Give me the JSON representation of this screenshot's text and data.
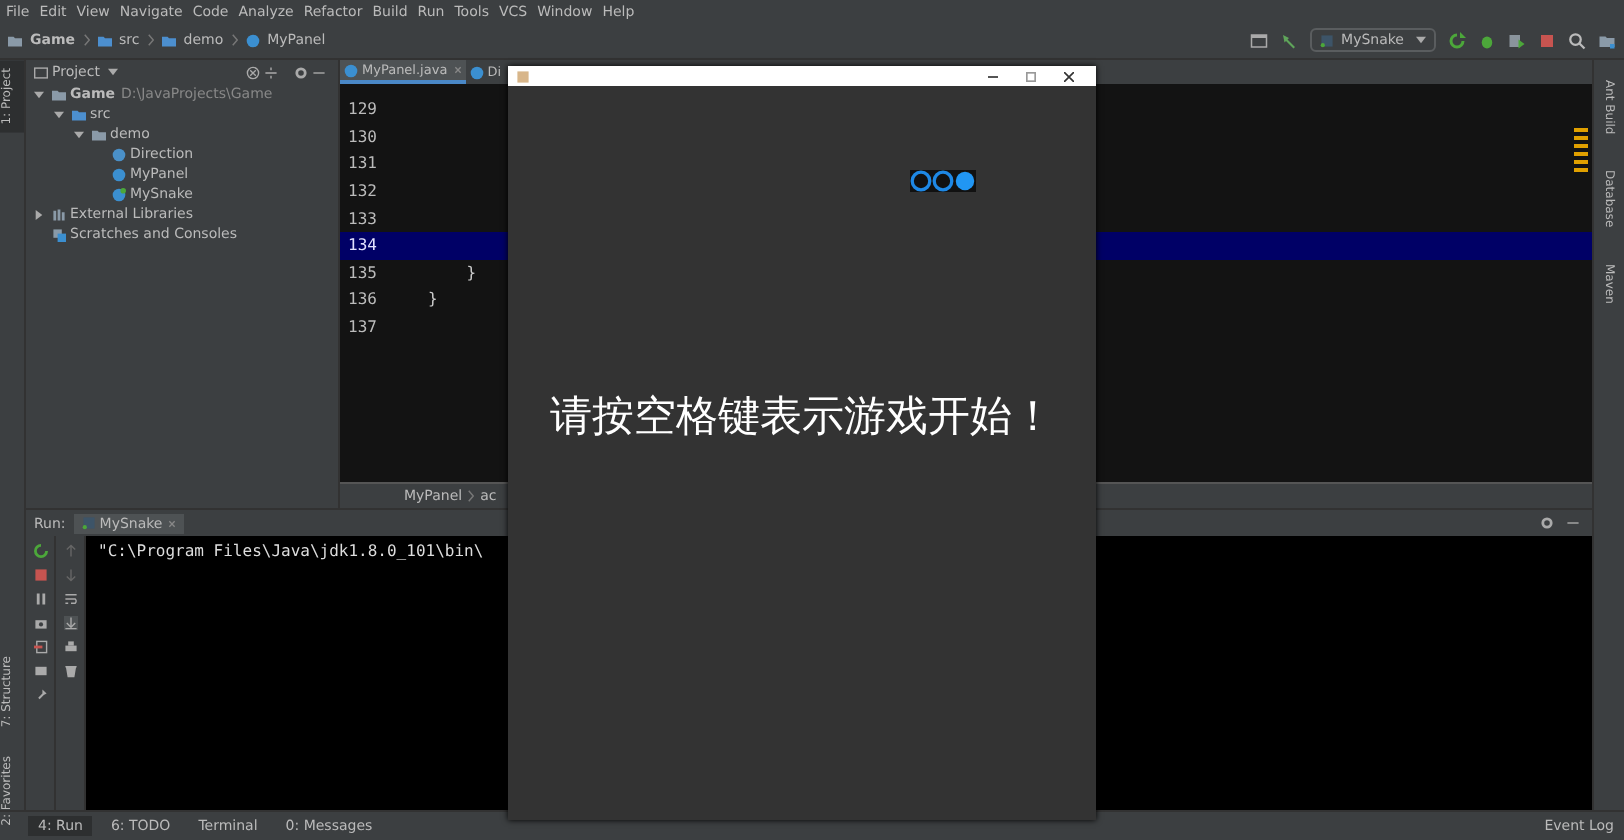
{
  "menu": [
    "File",
    "Edit",
    "View",
    "Navigate",
    "Code",
    "Analyze",
    "Refactor",
    "Build",
    "Run",
    "Tools",
    "VCS",
    "Window",
    "Help"
  ],
  "breadcrumb": [
    "Game",
    "src",
    "demo",
    "MyPanel"
  ],
  "toolbar": {
    "run_config": "MySnake"
  },
  "left_strip": [
    {
      "label": "1: Project",
      "selected": true
    },
    {
      "label": "7: Structure",
      "selected": false
    },
    {
      "label": "2: Favorites",
      "selected": false
    }
  ],
  "right_strip": [
    "Ant Build",
    "Database",
    "Maven"
  ],
  "project": {
    "title": "Project",
    "tree": [
      {
        "name": "Game",
        "path": "D:\\JavaProjects\\Game",
        "kind": "module",
        "expanded": true,
        "children": [
          {
            "name": "src",
            "kind": "folder",
            "expanded": true,
            "children": [
              {
                "name": "demo",
                "kind": "package",
                "expanded": true,
                "children": [
                  {
                    "name": "Direction",
                    "kind": "enum"
                  },
                  {
                    "name": "MyPanel",
                    "kind": "class"
                  },
                  {
                    "name": "MySnake",
                    "kind": "main"
                  }
                ]
              }
            ]
          }
        ]
      },
      {
        "name": "External Libraries",
        "kind": "library",
        "expanded": false
      },
      {
        "name": "Scratches and Consoles",
        "kind": "scratch"
      }
    ]
  },
  "editor": {
    "tabs": [
      {
        "label": "MyPanel.java",
        "selected": true
      },
      {
        "label": "Di",
        "selected": false
      }
    ],
    "lines": [
      {
        "number": "129",
        "current": false
      },
      {
        "number": "130",
        "current": false
      },
      {
        "number": "131",
        "current": false
      },
      {
        "number": "132",
        "current": false
      },
      {
        "number": "133",
        "current": false
      },
      {
        "number": "134",
        "current": true
      },
      {
        "number": "135",
        "code": "    }",
        "current": false
      },
      {
        "number": "136",
        "code": "}",
        "current": false
      },
      {
        "number": "137",
        "current": false
      }
    ],
    "breadcrumb": [
      "MyPanel",
      "ac"
    ]
  },
  "run": {
    "label": "Run:",
    "tab": "MySnake",
    "console": [
      "\"C:\\Program Files\\Java\\jdk1.8.0_101\\bin\\"
    ]
  },
  "bottom_tabs": [
    {
      "label": "4: Run",
      "selected": true
    },
    {
      "label": "6: TODO",
      "selected": false
    },
    {
      "label": "Terminal",
      "selected": false
    },
    {
      "label": "0: Messages",
      "selected": false
    }
  ],
  "event_log": "Event Log",
  "game_window": {
    "message": "请按空格键表示游戏开始！",
    "snake": [
      {
        "kind": "body"
      },
      {
        "kind": "body"
      },
      {
        "kind": "head"
      }
    ]
  }
}
